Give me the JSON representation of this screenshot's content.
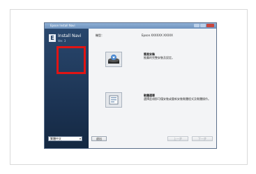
{
  "window": {
    "title": "Epson Install Navi"
  },
  "brand": {
    "name": "Install Navi",
    "version": "Ver. 3"
  },
  "model": {
    "label": "機型：",
    "value": "Epson XXXXXX XXXXX"
  },
  "options": [
    {
      "title": "簡易安裝",
      "desc": "推薦的完整安裝及設定。",
      "icon": "install-disk-icon",
      "selected": true
    },
    {
      "title": "軟體選單",
      "desc": "選擇此項即可僅安裝或重新安裝軟體程式及軟體操作。",
      "icon": "software-list-icon",
      "selected": false
    }
  ],
  "language": {
    "selected": "繁體中文"
  },
  "buttons": {
    "exit": "退出",
    "back": "上一步",
    "next": "下一步"
  },
  "colors": {
    "highlight": "#e01414",
    "sidebar": "#1a3150"
  }
}
